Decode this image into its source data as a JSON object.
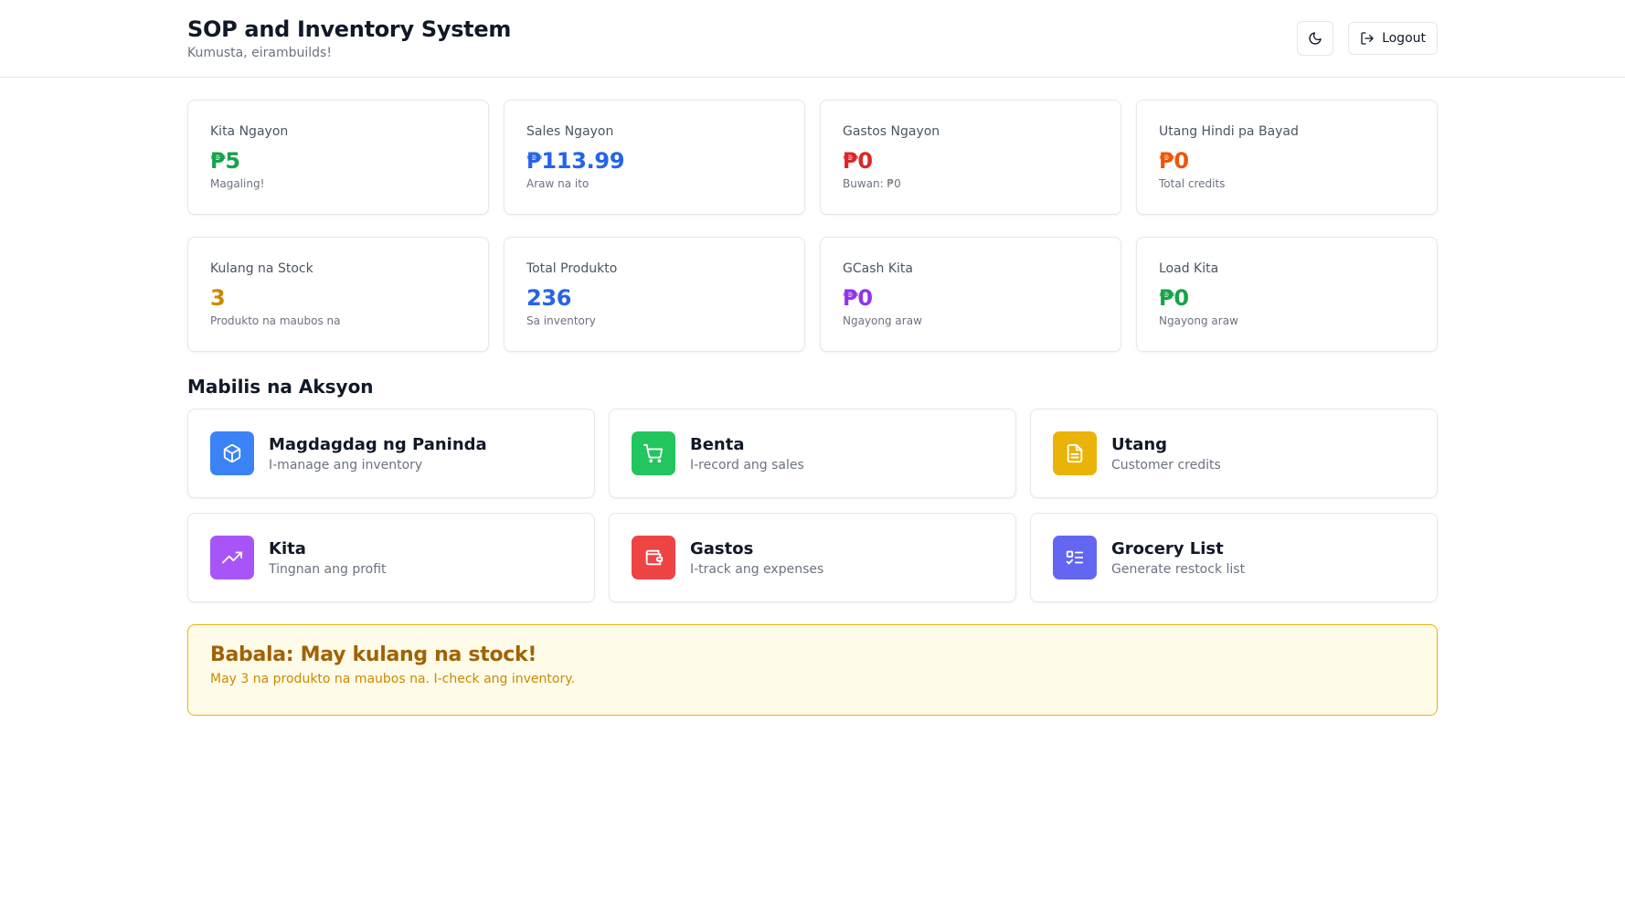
{
  "header": {
    "title": "SOP and Inventory System",
    "greeting": "Kumusta, eirambuilds!",
    "theme_icon": "moon-icon",
    "logout_icon": "logout-icon",
    "logout_label": "Logout"
  },
  "stats": [
    {
      "label": "Kita Ngayon",
      "value": "₱5",
      "note": "Magaling!",
      "color": "#16a34a"
    },
    {
      "label": "Sales Ngayon",
      "value": "₱113.99",
      "note": "Araw na ito",
      "color": "#2563eb"
    },
    {
      "label": "Gastos Ngayon",
      "value": "₱0",
      "note": "Buwan: ₱0",
      "color": "#dc2626"
    },
    {
      "label": "Utang Hindi pa Bayad",
      "value": "₱0",
      "note": "Total credits",
      "color": "#ea580c"
    },
    {
      "label": "Kulang na Stock",
      "value": "3",
      "note": "Produkto na maubos na",
      "color": "#ca8a04"
    },
    {
      "label": "Total Produkto",
      "value": "236",
      "note": "Sa inventory",
      "color": "#2563eb"
    },
    {
      "label": "GCash Kita",
      "value": "₱0",
      "note": "Ngayong araw",
      "color": "#9333ea"
    },
    {
      "label": "Load Kita",
      "value": "₱0",
      "note": "Ngayong araw",
      "color": "#16a34a"
    }
  ],
  "quick_actions": {
    "title": "Mabilis na Aksyon",
    "items": [
      {
        "title": "Magdagdag ng Paninda",
        "desc": "I-manage ang inventory",
        "icon": "box-icon",
        "color": "#3b82f6"
      },
      {
        "title": "Benta",
        "desc": "I-record ang sales",
        "icon": "cart-icon",
        "color": "#22c55e"
      },
      {
        "title": "Utang",
        "desc": "Customer credits",
        "icon": "document-icon",
        "color": "#eab308"
      },
      {
        "title": "Kita",
        "desc": "Tingnan ang profit",
        "icon": "trending-up-icon",
        "color": "#a855f7"
      },
      {
        "title": "Gastos",
        "desc": "I-track ang expenses",
        "icon": "wallet-icon",
        "color": "#ef4444"
      },
      {
        "title": "Grocery List",
        "desc": "Generate restock list",
        "icon": "checklist-icon",
        "color": "#6366f1"
      }
    ]
  },
  "alert": {
    "title": "Babala: May kulang na stock!",
    "text": "May 3 na produkto na maubos na. I-check ang inventory."
  }
}
